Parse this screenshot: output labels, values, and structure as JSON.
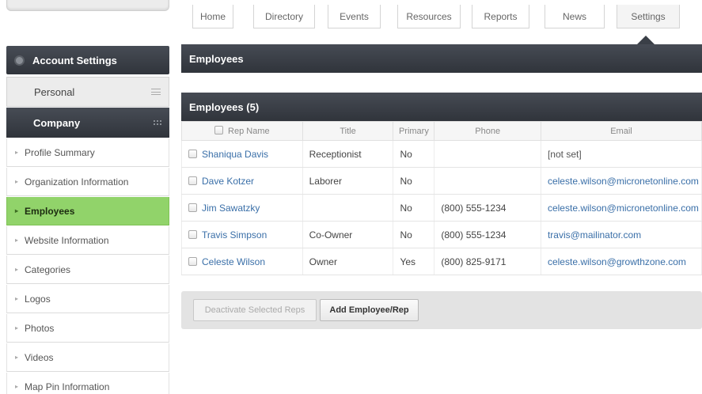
{
  "nav": {
    "tabs": [
      "Home",
      "Directory",
      "Events",
      "Resources",
      "Reports",
      "News",
      "Settings"
    ],
    "active": "Settings"
  },
  "sidebar": {
    "account_settings": "Account Settings",
    "personal": "Personal",
    "company": "Company",
    "items": [
      "Profile Summary",
      "Organization Information",
      "Employees",
      "Website Information",
      "Categories",
      "Logos",
      "Photos",
      "Videos",
      "Map Pin Information"
    ],
    "active_item": "Employees"
  },
  "main": {
    "page_title": "Employees",
    "table_title": "Employees (5)",
    "columns": [
      "Rep Name",
      "Title",
      "Primary",
      "Phone",
      "Email"
    ],
    "rows": [
      {
        "name": "Shaniqua Davis",
        "title": "Receptionist",
        "primary": "No",
        "phone": "",
        "email": "[not set]"
      },
      {
        "name": "Dave Kotzer",
        "title": "Laborer",
        "primary": "No",
        "phone": "",
        "email": "celeste.wilson@micronetonline.com"
      },
      {
        "name": "Jim Sawatzky",
        "title": "",
        "primary": "No",
        "phone": "(800) 555-1234",
        "email": "celeste.wilson@micronetonline.com"
      },
      {
        "name": "Travis Simpson",
        "title": "Co-Owner",
        "primary": "No",
        "phone": "(800) 555-1234",
        "email": "travis@mailinator.com"
      },
      {
        "name": "Celeste Wilson",
        "title": "Owner",
        "primary": "Yes",
        "phone": "(800) 825-9171",
        "email": "celeste.wilson@growthzone.com"
      }
    ],
    "deactivate_label": "Deactivate Selected Reps",
    "add_label": "Add Employee/Rep"
  },
  "colors": {
    "header_dark": "#3a3f47",
    "active_green": "#91d36a",
    "link_blue": "#3a6fa8"
  }
}
